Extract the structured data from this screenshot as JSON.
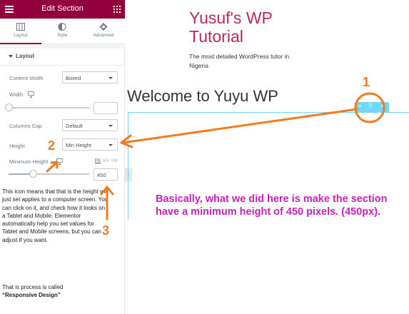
{
  "panel": {
    "header_title": "Edit Section",
    "tabs": [
      {
        "label": "Layout",
        "icon": "layout-icon",
        "active": true
      },
      {
        "label": "Style",
        "icon": "contrast-icon",
        "active": false
      },
      {
        "label": "Advanced",
        "icon": "gear-icon",
        "active": false
      }
    ],
    "section_title": "Layout",
    "content_width_label": "Content Width",
    "content_width_value": "Boxed",
    "width_label": "Width",
    "columns_gap_label": "Columns Gap",
    "columns_gap_value": "Default",
    "height_label": "Height",
    "height_value": "Min Height",
    "min_height_label": "Minimum Height",
    "min_height_value": "450",
    "units": [
      "PX",
      "VH",
      "VW"
    ],
    "active_unit": "PX",
    "min_height_slider_fraction": 0.3
  },
  "annotations": {
    "note": "This icon means that that is the height we just set applies to a computer screen. You can click on it, and check how it looks on a Tablet and Mobile. Elementor automatically help you set values for Tablet and Mobile screens, but you can adjust if you want.",
    "note_line2": "That is process is called",
    "note_line3": "“Responsive Design”",
    "explanation": "Basically, what we did here is make the section have a minimum height of 450 pixels. (450px).",
    "marker_1": "1",
    "marker_2": "2",
    "marker_3": "3",
    "color": "#f47a1f"
  },
  "preview": {
    "site_title": "Yusuf's WP Tutorial",
    "tagline": "The most detailed WordPress tutor in Nigeria",
    "heading": "Welcome to Yuyu WP",
    "handle_add": "+",
    "handle_move": "⠿",
    "handle_close": "×"
  },
  "colors": {
    "header": "#93003c",
    "site_title": "#b7295a",
    "explanation": "#c523b7",
    "section_outline": "#71d7f7"
  }
}
